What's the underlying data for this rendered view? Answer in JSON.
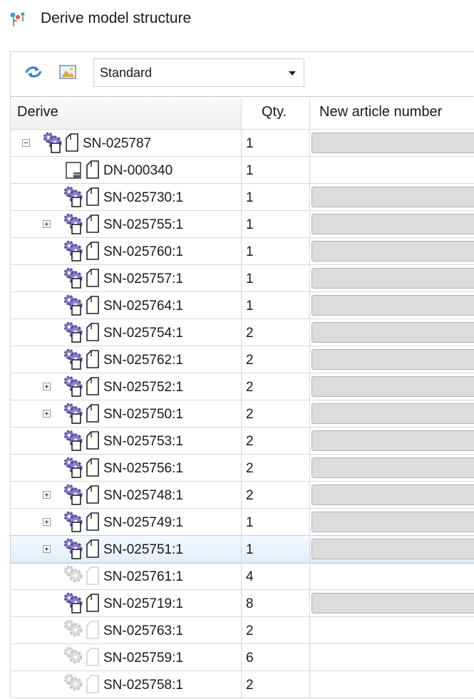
{
  "window": {
    "title": "Derive model structure"
  },
  "toolbar": {
    "refresh_icon": "refresh-arrows-icon",
    "image_icon": "picture-icon",
    "view_select": {
      "value": "Standard"
    }
  },
  "table": {
    "columns": {
      "derive": "Derive",
      "qty": "Qty.",
      "article": "New article number"
    },
    "rows": [
      {
        "expander": "minus",
        "type": "assembly",
        "label": "SN-025787",
        "qty": "1",
        "field": true
      },
      {
        "expander": "",
        "type": "drawing",
        "label": "DN-000340",
        "qty": "1",
        "field": false
      },
      {
        "expander": "",
        "type": "assembly",
        "label": "SN-025730:1",
        "qty": "1",
        "field": true
      },
      {
        "expander": "plus",
        "type": "assembly",
        "label": "SN-025755:1",
        "qty": "1",
        "field": true
      },
      {
        "expander": "",
        "type": "assembly",
        "label": "SN-025760:1",
        "qty": "1",
        "field": true
      },
      {
        "expander": "",
        "type": "assembly",
        "label": "SN-025757:1",
        "qty": "1",
        "field": true
      },
      {
        "expander": "",
        "type": "assembly",
        "label": "SN-025764:1",
        "qty": "1",
        "field": true
      },
      {
        "expander": "",
        "type": "assembly",
        "label": "SN-025754:1",
        "qty": "2",
        "field": true
      },
      {
        "expander": "",
        "type": "assembly",
        "label": "SN-025762:1",
        "qty": "2",
        "field": true
      },
      {
        "expander": "plus",
        "type": "assembly",
        "label": "SN-025752:1",
        "qty": "2",
        "field": true
      },
      {
        "expander": "plus",
        "type": "assembly",
        "label": "SN-025750:1",
        "qty": "2",
        "field": true
      },
      {
        "expander": "",
        "type": "assembly",
        "label": "SN-025753:1",
        "qty": "2",
        "field": true
      },
      {
        "expander": "",
        "type": "assembly",
        "label": "SN-025756:1",
        "qty": "2",
        "field": true
      },
      {
        "expander": "plus",
        "type": "assembly",
        "label": "SN-025748:1",
        "qty": "2",
        "field": true
      },
      {
        "expander": "plus",
        "type": "assembly",
        "label": "SN-025749:1",
        "qty": "1",
        "field": true
      },
      {
        "expander": "plus",
        "type": "assembly",
        "label": "SN-025751:1",
        "qty": "1",
        "field": true,
        "selected": true
      },
      {
        "expander": "",
        "type": "faded",
        "label": "SN-025761:1",
        "qty": "4",
        "field": false
      },
      {
        "expander": "",
        "type": "assembly",
        "label": "SN-025719:1",
        "qty": "8",
        "field": true
      },
      {
        "expander": "",
        "type": "faded",
        "label": "SN-025763:1",
        "qty": "2",
        "field": false
      },
      {
        "expander": "",
        "type": "faded",
        "label": "SN-025759:1",
        "qty": "6",
        "field": false
      },
      {
        "expander": "",
        "type": "faded",
        "label": "SN-025758:1",
        "qty": "2",
        "field": false
      }
    ]
  },
  "colors": {
    "selected_row": "#e2edf9",
    "field_gray": "#dcdcdc",
    "gear_purple": "#5a4a96"
  }
}
